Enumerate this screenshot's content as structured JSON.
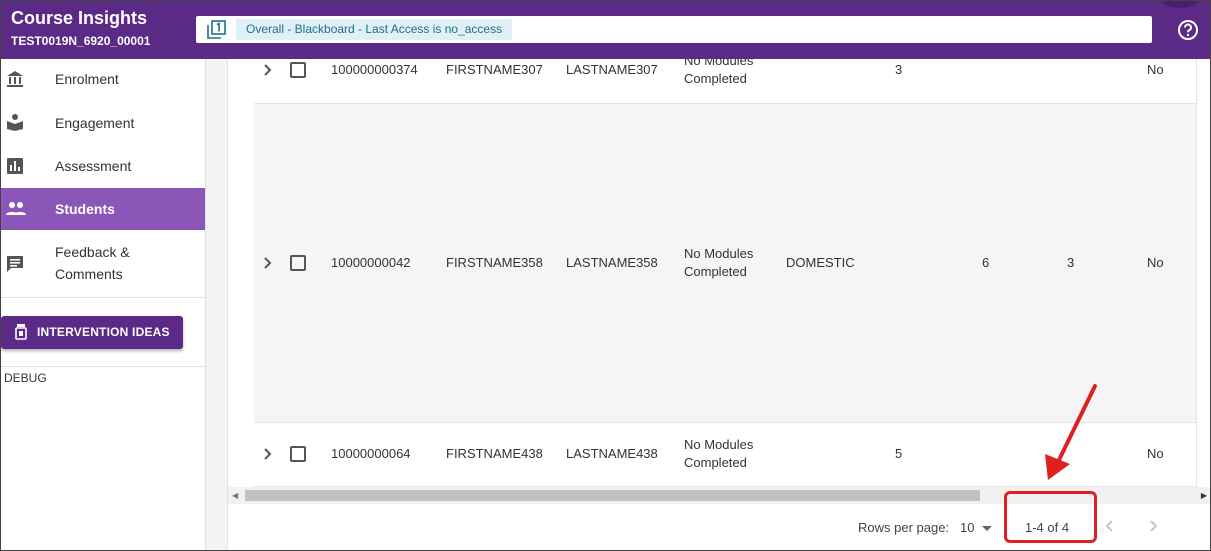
{
  "header": {
    "app_title": "Course Insights",
    "course_code": "TEST0019N_6920_00001",
    "filter_chip": "Overall - Blackboard - Last Access is no_access",
    "filter_icon": "filter-number-1-icon",
    "help_icon": "help-circle-icon"
  },
  "sidebar": {
    "items": [
      {
        "label": "Enrolment",
        "icon": "bank-icon",
        "active": false
      },
      {
        "label": "Engagement",
        "icon": "book-reader-icon",
        "active": false
      },
      {
        "label": "Assessment",
        "icon": "bar-chart-icon",
        "active": false
      },
      {
        "label": "Students",
        "icon": "people-icon",
        "active": true
      },
      {
        "label": "Feedback &",
        "label2": "Comments",
        "icon": "comment-icon",
        "active": false
      }
    ],
    "intervention_button": "INTERVENTION IDEAS",
    "debug": "DEBUG"
  },
  "table": {
    "rows": [
      {
        "id": "100000000374",
        "first": "FIRSTNAME307",
        "last": "LASTNAME307",
        "status1": "No Modules",
        "status2": "Completed",
        "residency": "",
        "col_a": "3",
        "col_b": "",
        "col_c": "",
        "flag": "No"
      },
      {
        "id": "10000000042",
        "first": "FIRSTNAME358",
        "last": "LASTNAME358",
        "status1": "No Modules",
        "status2": "Completed",
        "residency": "DOMESTIC",
        "col_a": "",
        "col_b": "6",
        "col_c": "3",
        "flag": "No"
      },
      {
        "id": "10000000064",
        "first": "FIRSTNAME438",
        "last": "LASTNAME438",
        "status1": "No Modules",
        "status2": "Completed",
        "residency": "",
        "col_a": "5",
        "col_b": "",
        "col_c": "",
        "flag": "No"
      }
    ]
  },
  "pagination": {
    "rows_per_page_label": "Rows per page:",
    "rows_per_page_value": "10",
    "range": "1-4 of 4"
  },
  "colors": {
    "brand_purple": "#5a2a86",
    "active_nav": "#8a57b8",
    "chip_bg": "#dff1f6",
    "annotation_red": "#e0201e"
  }
}
